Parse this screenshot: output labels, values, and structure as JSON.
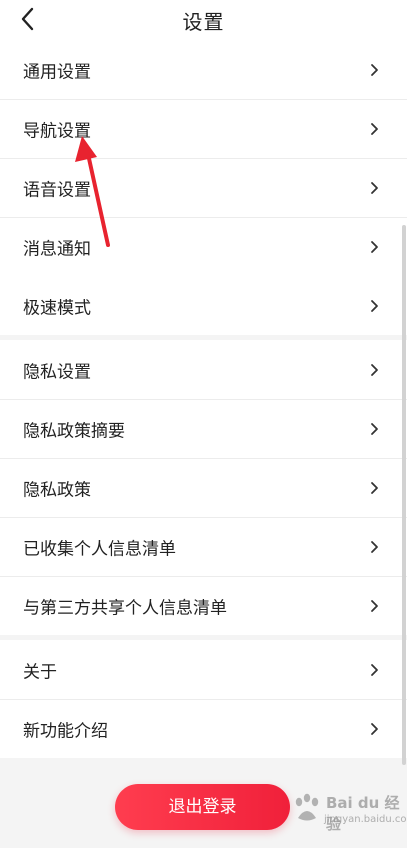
{
  "header": {
    "title": "设置"
  },
  "groups": [
    {
      "items": [
        "通用设置",
        "导航设置",
        "语音设置",
        "消息通知"
      ]
    },
    {
      "items": [
        "极速模式"
      ]
    },
    {
      "items": [
        "隐私设置",
        "隐私政策摘要",
        "隐私政策",
        "已收集个人信息清单",
        "与第三方共享个人信息清单"
      ]
    },
    {
      "items": [
        "关于",
        "新功能介绍"
      ]
    }
  ],
  "logout": {
    "label": "退出登录"
  },
  "watermark": {
    "text": "Bai du 经验",
    "sub": "jingyan.baidu.com"
  },
  "colors": {
    "accent": "#f0203a",
    "arrow": "#e8232f"
  },
  "icons": {
    "back": "chevron-left-icon",
    "row": "chevron-right-icon"
  }
}
